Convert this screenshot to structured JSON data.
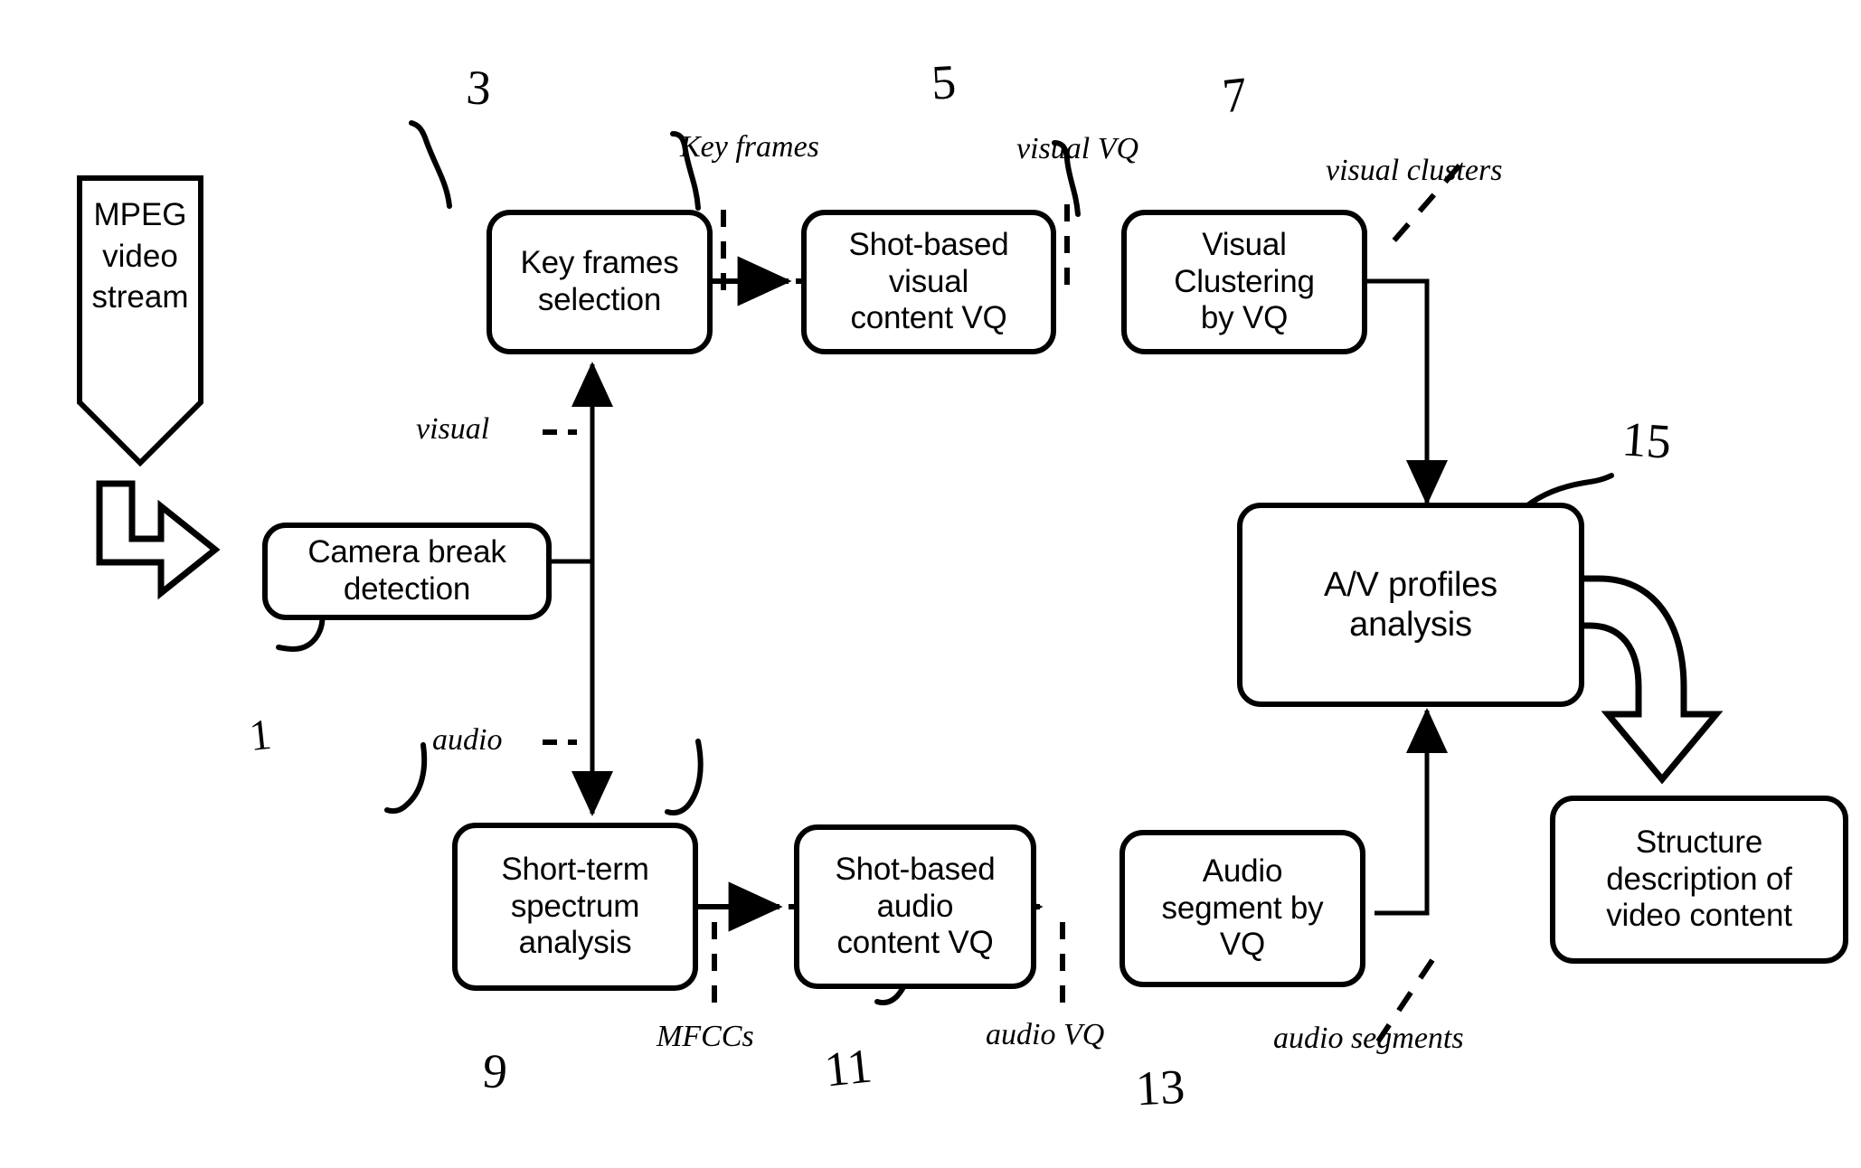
{
  "figure": {
    "type": "patent-flow-diagram",
    "title": "MPEG video stream structure analysis flow"
  },
  "input_block": {
    "label": "MPEG\nvideo\nstream",
    "shape": "downward-pentagon-arrow"
  },
  "boxes": [
    {
      "id": "camera_break",
      "label": "Camera break\ndetection",
      "ref": "1"
    },
    {
      "id": "key_frames",
      "label": "Key frames\nselection",
      "ref": "3"
    },
    {
      "id": "shot_visual_vq",
      "label": "Shot-based\nvisual\ncontent VQ",
      "ref": "5"
    },
    {
      "id": "visual_cluster",
      "label": "Visual\nClustering\nby VQ",
      "ref": "7"
    },
    {
      "id": "short_term",
      "label": "Short-term\nspectrum\nanalysis",
      "ref": "9"
    },
    {
      "id": "shot_audio_vq",
      "label": "Shot-based\naudio\ncontent VQ",
      "ref": "11"
    },
    {
      "id": "audio_segment",
      "label": "Audio\nsegment by\nVQ",
      "ref": "13"
    },
    {
      "id": "av_profiles",
      "label": "A/V profiles\nanalysis",
      "ref": "15"
    }
  ],
  "output_block": {
    "label": "Structure\ndescription of\nvideo content"
  },
  "signal_labels": [
    {
      "id": "visual",
      "text": "visual"
    },
    {
      "id": "audio",
      "text": "audio"
    },
    {
      "id": "key_frames_sig",
      "text": "Key frames"
    },
    {
      "id": "visual_vq",
      "text": "visual VQ"
    },
    {
      "id": "visual_clusters",
      "text": "visual clusters"
    },
    {
      "id": "mfccs",
      "text": "MFCCs"
    },
    {
      "id": "audio_vq",
      "text": "audio VQ"
    },
    {
      "id": "audio_segments",
      "text": "audio segments"
    }
  ],
  "reference_numerals": [
    "1",
    "3",
    "5",
    "7",
    "9",
    "11",
    "13",
    "15"
  ],
  "colors": {
    "ink": "#000000",
    "paper": "#ffffff"
  }
}
